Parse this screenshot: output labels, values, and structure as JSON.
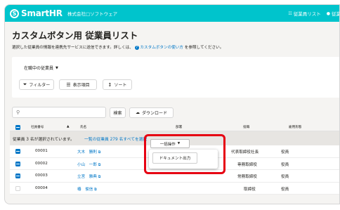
{
  "header": {
    "logo_mark": "S",
    "logo_text": "SmartHR",
    "company": "株式会社□ソフトウェア",
    "nav": [
      {
        "icon": "list-icon",
        "label": "従業員リスト"
      },
      {
        "icon": "user-icon",
        "label": "従業"
      }
    ]
  },
  "page": {
    "title": "カスタムボタン用 従業員リスト",
    "description_prefix": "選択した従業員の情報を連携先サービスに送信できます。詳しくは、",
    "description_link": "カスタムボタンの使い方",
    "description_suffix": "を参照してください。"
  },
  "filters": {
    "status_select": "在職中の従業員",
    "filter_label": "フィルター",
    "columns_label": "表示項目",
    "sort_label": "ソート"
  },
  "search": {
    "placeholder": "",
    "search_button": "検索",
    "download_button": "ダウンロード"
  },
  "table": {
    "columns": [
      "社員番号",
      "氏名",
      "部署",
      "役職",
      "雇用形態"
    ],
    "selection_message": "従業員 3 名が選択されています。",
    "select_all_link": "一覧の従業員 279 名すべてを選択",
    "rows": [
      {
        "checked": true,
        "id": "00001",
        "name": "大木　勝則",
        "title": "代表取締役社長",
        "type": "役員"
      },
      {
        "checked": true,
        "id": "00002",
        "name": "小山　一郎",
        "title": "専務取締役",
        "type": "役員"
      },
      {
        "checked": true,
        "id": "00003",
        "name": "立宮　雅典",
        "title": "常務取締役",
        "type": "役員"
      },
      {
        "checked": false,
        "id": "00004",
        "name": "椿　俊信",
        "title": "取締役",
        "type": "役員"
      }
    ]
  },
  "bulk": {
    "button_label": "一括操作",
    "menu_item": "ドキュメント出力"
  },
  "colors": {
    "brand": "#00c4cc",
    "link": "#0077c7",
    "highlight": "#e60012"
  }
}
